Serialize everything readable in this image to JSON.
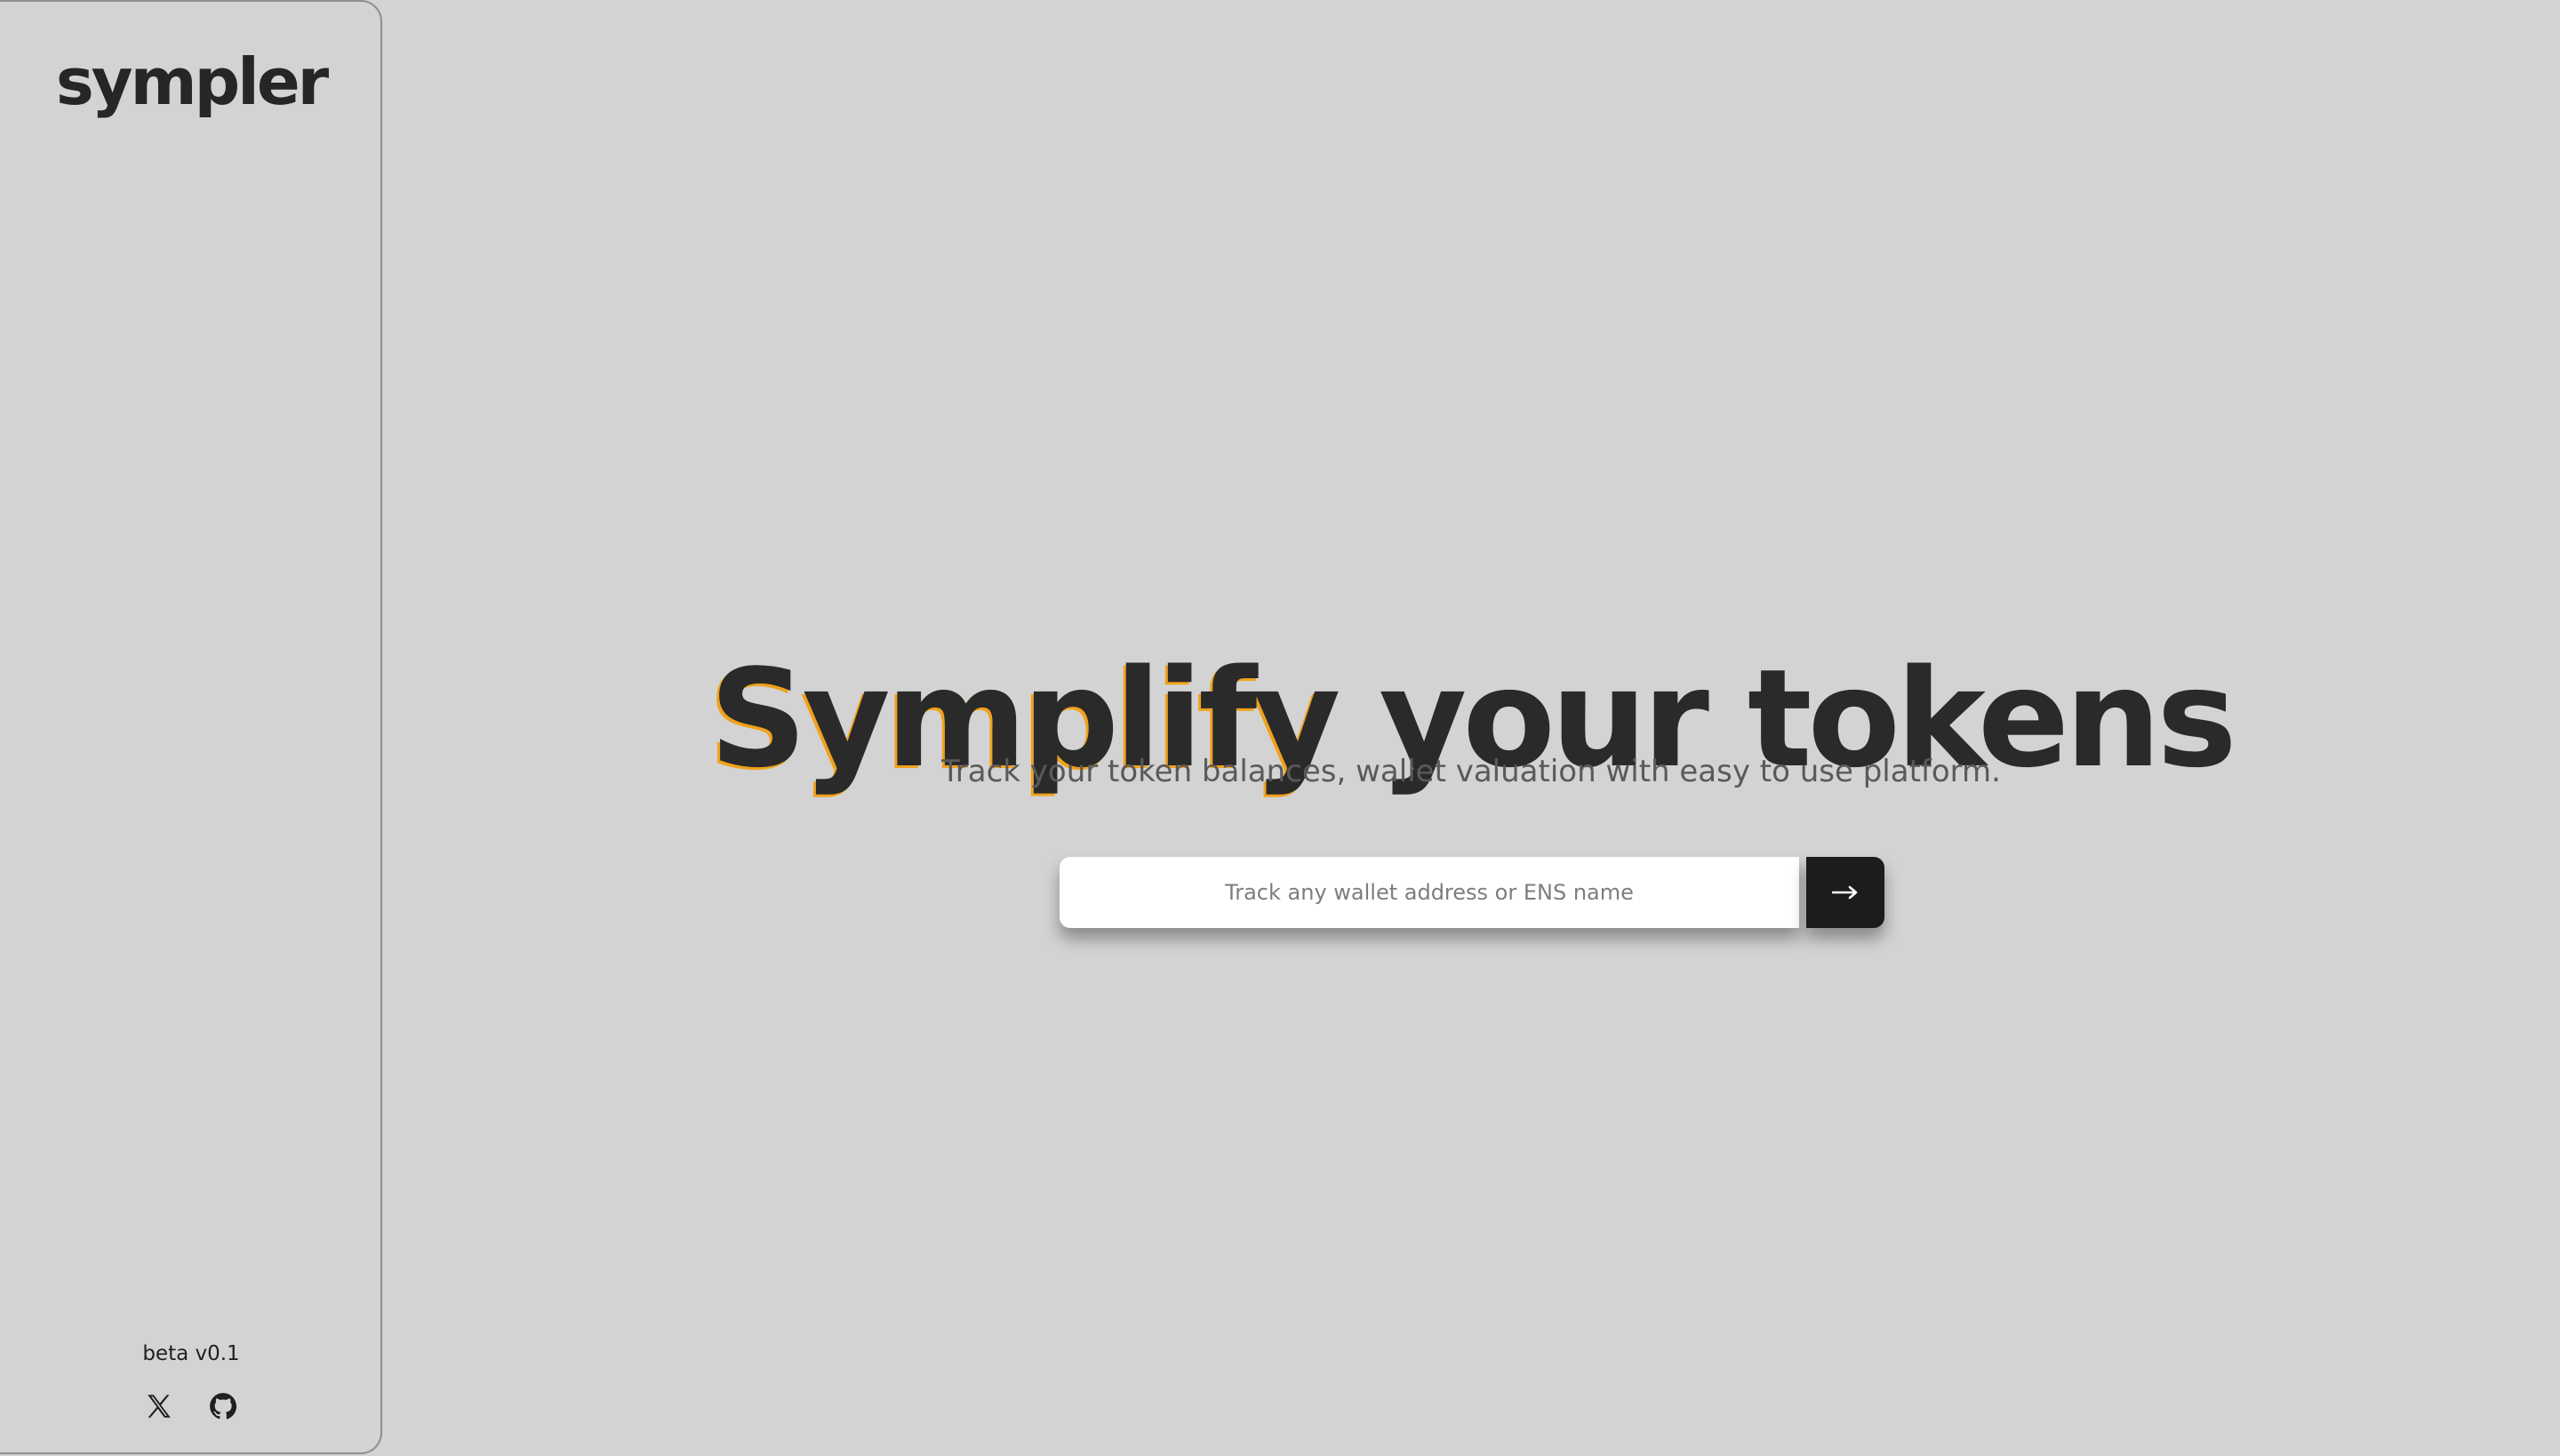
{
  "app": {
    "logo_text": "sympler",
    "version_label": "beta v0.1"
  },
  "sidebar": {
    "social_links": [
      {
        "name": "x-icon",
        "label": "X"
      },
      {
        "name": "github-icon",
        "label": "GitHub"
      }
    ]
  },
  "hero": {
    "title_accent": "Symplify",
    "title_rest": " your tokens",
    "subtitle": "Track your token balances, wallet valuation with easy to use platform."
  },
  "search": {
    "value": "",
    "placeholder": "Track any wallet address or ENS name",
    "submit_icon": "arrow-right-icon"
  },
  "colors": {
    "background": "#d3d3d3",
    "text": "#2a2a2a",
    "accent_outline": "#f0a21c",
    "button_bg": "#1c1c1c"
  }
}
